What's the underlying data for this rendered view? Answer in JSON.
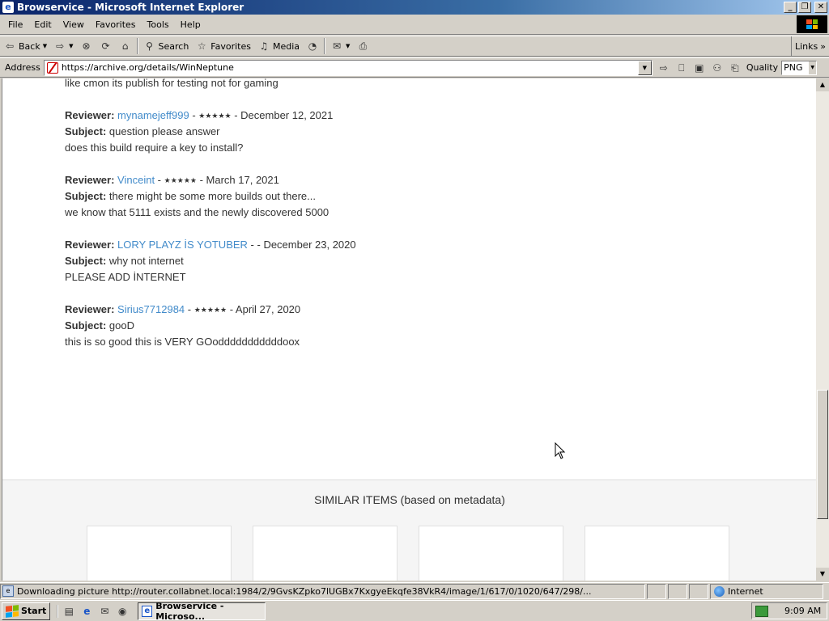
{
  "window": {
    "title": "Browservice - Microsoft Internet Explorer"
  },
  "menu": [
    "File",
    "Edit",
    "View",
    "Favorites",
    "Tools",
    "Help"
  ],
  "toolbar": {
    "back": "Back",
    "search": "Search",
    "favorites": "Favorites",
    "media": "Media",
    "links": "Links"
  },
  "address": {
    "label": "Address",
    "url": "https://archive.org/details/WinNeptune",
    "quality_label": "Quality",
    "quality_value": "PNG"
  },
  "page": {
    "cut_line": "like cmon its publish for testing not for gaming",
    "reviewer_label": "Reviewer:",
    "subject_label": "Subject:",
    "reviews": [
      {
        "reviewer": "mynamejeff999",
        "sep1": " - ",
        "stars": "★★★★★",
        "sep2": " - ",
        "date": "December 12, 2021",
        "subject": "question please answer",
        "body": "does this build require a key to install?"
      },
      {
        "reviewer": "Vinceint",
        "sep1": " - ",
        "stars": "★★★★★",
        "sep2": " - ",
        "date": "March 17, 2021",
        "subject": "there might be some more builds out there...",
        "body": "we know that 5111 exists and the newly discovered 5000"
      },
      {
        "reviewer": "LORY PLAYZ İS YOTUBER",
        "sep1": " - ",
        "stars": "",
        "sep2": " - ",
        "date": "December 23, 2020",
        "subject": "why not internet",
        "body": "PLEASE ADD İNTERNET"
      },
      {
        "reviewer": "Sirius7712984",
        "sep1": " - ",
        "stars": "★★★★★",
        "sep2": " - ",
        "date": "April 27, 2020",
        "subject": "gooD",
        "body": "this is so good this is VERY GOodddddddddddoox"
      }
    ],
    "similar_title": "SIMILAR ITEMS (based on metadata)"
  },
  "status": {
    "text": "Downloading picture http://router.collabnet.local:1984/2/9GvsKZpko7lUGBx7KxgyeEkqfe38VkR4/image/1/617/0/1020/647/298/...",
    "zone": "Internet"
  },
  "taskbar": {
    "start": "Start",
    "task": "Browservice - Microso...",
    "clock": "9:09 AM"
  }
}
